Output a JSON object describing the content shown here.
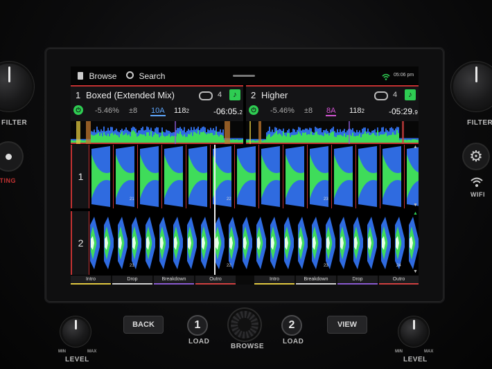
{
  "screen": {
    "browse_label": "Browse",
    "search_label": "Search",
    "time": "05:06 pm",
    "decks": [
      {
        "number": "1",
        "title": "Boxed (Extended Mix)",
        "loop_count": "4",
        "pitch": "-5.46%",
        "range": "±8",
        "key": "10A",
        "key_color": "#5fa8ff",
        "bpm_main": "118",
        "bpm_frac": "2",
        "remaining_main": "-06:05.",
        "remaining_frac": "2"
      },
      {
        "number": "2",
        "title": "Higher",
        "loop_count": "4",
        "pitch": "-5.46%",
        "range": "±8",
        "key": "8A",
        "key_color": "#d455d4",
        "bpm_main": "118",
        "bpm_frac": "2",
        "remaining_main": "-05:29.",
        "remaining_frac": "9"
      }
    ],
    "lanes": [
      {
        "label": "1",
        "bar_numbers": [
          "21",
          "22"
        ]
      },
      {
        "label": "2",
        "bar_numbers": [
          "21",
          "22",
          "23",
          "24"
        ]
      }
    ],
    "lane1_extra_bars": [
      "23",
      "24"
    ],
    "deck1_sections": [
      {
        "label": "Intro",
        "color": "#e0c840"
      },
      {
        "label": "Drop",
        "color": "#d0d0d0"
      },
      {
        "label": "Breakdown",
        "color": "#8a5ad0"
      },
      {
        "label": "Outro",
        "color": "#d04040"
      }
    ],
    "deck2_sections": [
      {
        "label": "Intro",
        "color": "#e0c840"
      },
      {
        "label": "Breakdown",
        "color": "#d0d0d0"
      },
      {
        "label": "Drop",
        "color": "#8a5ad0"
      },
      {
        "label": "Outro",
        "color": "#d04040"
      }
    ]
  },
  "hardware": {
    "filter_label": "FILTER",
    "wifi_label": "WIFI",
    "lighting_label": "LIGHTING",
    "back_label": "BACK",
    "view_label": "VIEW",
    "browse_label": "BROWSE",
    "load_label": "LOAD",
    "level_label": "LEVEL",
    "min_label": "MIN",
    "max_label": "MAX",
    "deck1_button": "1",
    "deck2_button": "2"
  },
  "colors": {
    "accent_red": "#c43232",
    "waveform_blue": "#2f6be0",
    "waveform_green": "#3fdc5a",
    "sync_green": "#2ecc52"
  }
}
